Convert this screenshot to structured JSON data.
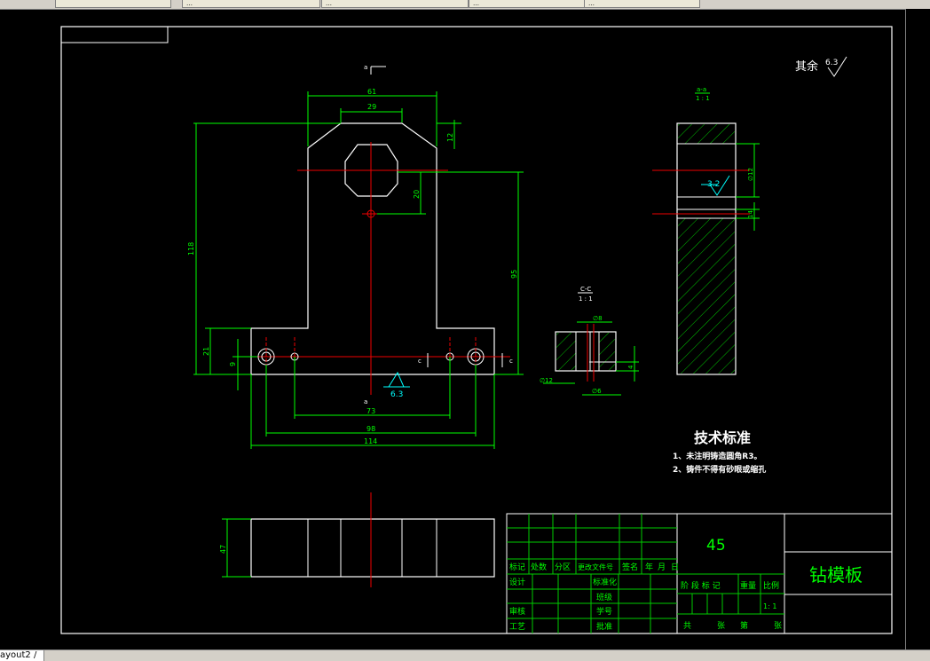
{
  "app": {
    "tabs": [
      {
        "label": ""
      },
      {
        "label": "…"
      },
      {
        "label": "…"
      },
      {
        "label": "…"
      },
      {
        "label": "…"
      }
    ],
    "layout_tab": "ayout2 /"
  },
  "drawing": {
    "roughness": {
      "prefix": "其余",
      "value": "6.3"
    },
    "section_labels": {
      "a": "a",
      "c": "c"
    },
    "section_aa": {
      "title": "a-a",
      "scale": "1 : 1",
      "roughness": "3.2"
    },
    "section_cc": {
      "title": "C-C",
      "scale": "1 : 1"
    },
    "dims": {
      "top_width": "61",
      "hex_width": "29",
      "chamfer_h": "12",
      "hole_offset": "20",
      "total_height": "118",
      "right_height": "95",
      "base_height": "21",
      "base_small": "9",
      "d73": "73",
      "d98": "98",
      "d114": "114",
      "view_height": "47",
      "aa_d1": "∅12",
      "aa_d2": "14",
      "cc_d1": "∅8",
      "cc_d2": "∅12",
      "cc_d3": "4",
      "cc_d4": "∅6"
    },
    "bottom_roughness": "6.3",
    "tech": {
      "title": "技术标准",
      "line1": "1、未注明铸造圆角R3。",
      "line2": "2、铸件不得有砂眼或缩孔"
    },
    "title_block": {
      "material": "45",
      "part_name": "钻模板",
      "row_labels": [
        "标记",
        "处数",
        "分区",
        "更改文件号",
        "签名",
        "年",
        "月",
        "日"
      ],
      "design": "设计",
      "standard": "标准化",
      "check": "审核",
      "process": "工艺",
      "level": "班级",
      "student_no": "学号",
      "approve": "批准",
      "stage_mark": "阶 段 标 记",
      "weight": "重量",
      "scale": "比例",
      "scale_value": "1: 1",
      "total": "共",
      "sheets": "张",
      "no": "第",
      "sheet": "张"
    }
  }
}
